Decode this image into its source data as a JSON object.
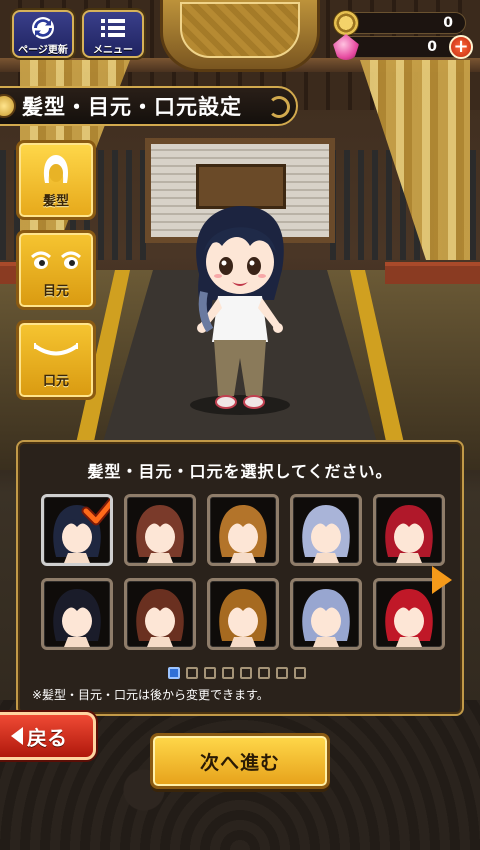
{
  "hud": {
    "refresh_label": "ページ更新",
    "menu_label": "メニュー",
    "coins": "0",
    "gems": "0",
    "plus_label": "+"
  },
  "title": "髪型・目元・口元設定",
  "tabs": [
    {
      "label": "髪型",
      "icon": "hair-icon"
    },
    {
      "label": "目元",
      "icon": "eyes-icon"
    },
    {
      "label": "口元",
      "icon": "mouth-icon"
    }
  ],
  "panel": {
    "prompt": "髪型・目元・口元を選択してください。",
    "note": "※髪型・目元・口元は後から変更できます。",
    "page_count": 8,
    "current_page": 1,
    "hair_options": [
      {
        "color": "#1f2740",
        "selected": true
      },
      {
        "color": "#7a3a2a",
        "selected": false
      },
      {
        "color": "#b3742a",
        "selected": false
      },
      {
        "color": "#a9b4d8",
        "selected": false
      },
      {
        "color": "#b0182a",
        "selected": false
      },
      {
        "color": "#1a1c2a",
        "selected": false
      },
      {
        "color": "#6a3020",
        "selected": false
      },
      {
        "color": "#a66a20",
        "selected": false
      },
      {
        "color": "#98a6d0",
        "selected": false
      },
      {
        "color": "#c01828",
        "selected": false
      }
    ]
  },
  "buttons": {
    "back_label": "戻る",
    "next_label": "次へ進む"
  },
  "colors": {
    "accent_gold": "#d2aa4e",
    "back_red": "#d8301e",
    "next_yellow": "#f6c531"
  }
}
